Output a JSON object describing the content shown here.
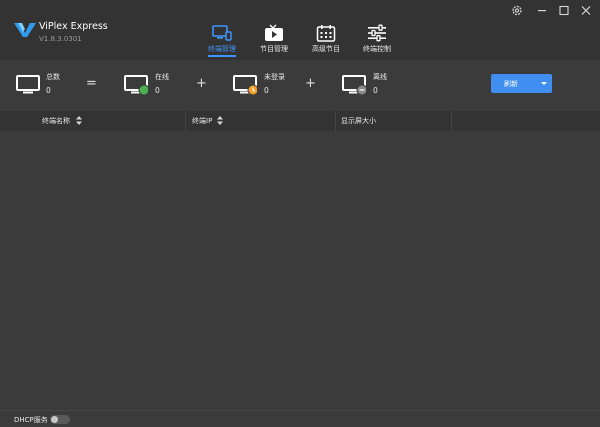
{
  "app": {
    "name": "ViPlex Express",
    "version": "V1.8.3.0301"
  },
  "nav": {
    "tabs": [
      {
        "label": "终端管理",
        "icon": "terminal-manage-icon",
        "active": true
      },
      {
        "label": "节目管理",
        "icon": "play-icon",
        "active": false
      },
      {
        "label": "高级节目",
        "icon": "calendar-icon",
        "active": false
      },
      {
        "label": "终端控制",
        "icon": "sliders-icon",
        "active": false
      }
    ]
  },
  "window_controls": [
    "gear-icon",
    "minimize-icon",
    "maximize-icon",
    "close-icon"
  ],
  "stats": {
    "total": {
      "label": "总数",
      "count": "0"
    },
    "online": {
      "label": "在线",
      "count": "0",
      "status_color": "#4caf50"
    },
    "not_logged_in": {
      "label": "未登录",
      "count": "0",
      "status_color": "#f0a030"
    },
    "offline": {
      "label": "离线",
      "count": "0",
      "status_color": "#8a8a8a"
    },
    "operators": [
      "=",
      "+",
      "+"
    ]
  },
  "toolbar": {
    "refresh_label": "刷新"
  },
  "table": {
    "columns": [
      {
        "label": "终端名称",
        "sortable": true
      },
      {
        "label": "终端IP",
        "sortable": true
      },
      {
        "label": "显示屏大小",
        "sortable": false
      }
    ],
    "rows": []
  },
  "footer": {
    "dhcp_label": "DHCP服务",
    "dhcp_enabled": false
  },
  "colors": {
    "accent": "#3f95ff",
    "button": "#3f8ef0",
    "header_bg": "#333333",
    "body_bg": "#3b3b3b"
  }
}
